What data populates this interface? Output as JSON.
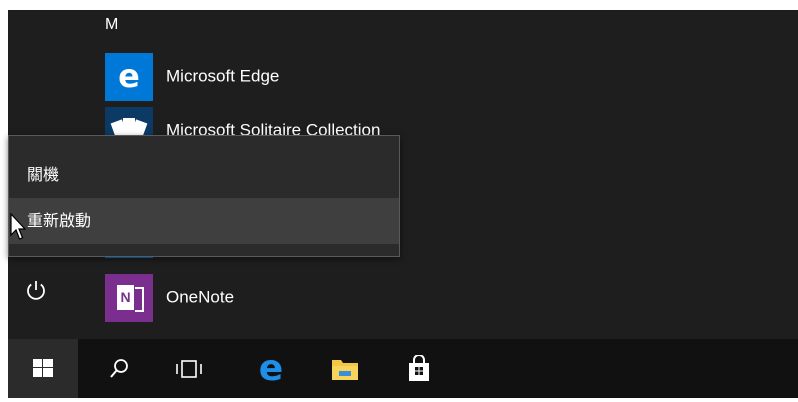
{
  "start_menu": {
    "letter_header": "M",
    "apps": [
      {
        "label": "Microsoft Edge",
        "icon": "edge-icon",
        "tile_color": "#0078d7"
      },
      {
        "label": "Microsoft Solitaire Collection",
        "icon": "solitaire-icon",
        "tile_color": "#0b3a64"
      },
      {
        "label": "OneNote",
        "icon": "onenote-icon",
        "tile_color": "#7a2f8f"
      }
    ],
    "onenote_glyph": "N"
  },
  "power_menu": {
    "items": [
      {
        "label": "關機"
      },
      {
        "label": "重新啟動",
        "hovered": true
      }
    ]
  },
  "taskbar": {
    "buttons": [
      "windows-start-icon",
      "search-icon",
      "task-view-icon",
      "edge-icon",
      "file-explorer-icon",
      "store-icon"
    ],
    "background": "#111111"
  },
  "colors": {
    "accent": "#0078d7",
    "menu_bg": "#1e1e1e",
    "flyout_bg": "#2b2b2b"
  }
}
